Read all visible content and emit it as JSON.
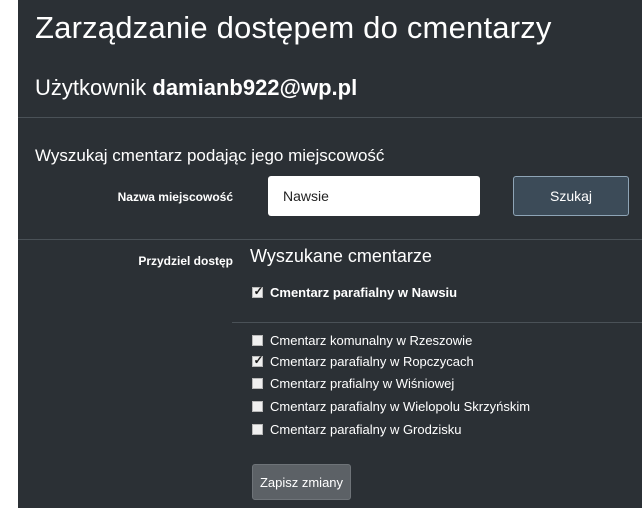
{
  "page": {
    "title": "Zarządzanie dostępem do cmentarzy",
    "user_prefix": "Użytkownik",
    "user_email": "damianb922@wp.pl"
  },
  "search": {
    "heading": "Wyszukaj cmentarz podając jego miejscowość",
    "field_label": "Nazwa miejscowość",
    "value": "Nawsie",
    "button_label": "Szukaj"
  },
  "access": {
    "label": "Przydziel dostęp",
    "results_heading": "Wyszukane cmentarze",
    "found": [
      {
        "label": "Cmentarz parafialny w Nawsiu",
        "checked": true
      }
    ],
    "assigned": [
      {
        "label": "Cmentarz komunalny w Rzeszowie",
        "checked": false
      },
      {
        "label": "Cmentarz parafialny w Ropczycach",
        "checked": true
      },
      {
        "label": "Cmentarz prafialny w Wiśniowej",
        "checked": false
      },
      {
        "label": "Cmentarz parafialny w Wielopolu Skrzyńskim",
        "checked": false
      },
      {
        "label": "Cmentarz parafialny w Grodzisku",
        "checked": false
      }
    ],
    "save_label": "Zapisz zmiany"
  },
  "colors": {
    "panel_bg": "#2b3035",
    "search_button_bg": "#3c4b58",
    "save_button_bg": "#5c6166"
  }
}
